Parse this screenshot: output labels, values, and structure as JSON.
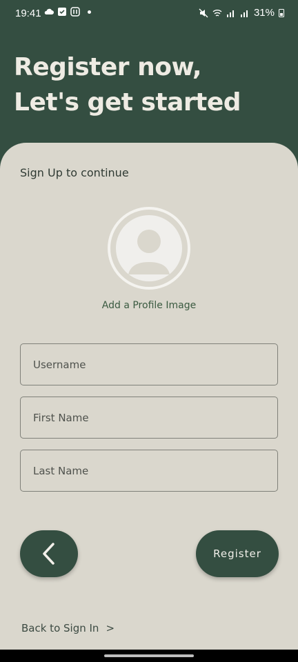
{
  "status_bar": {
    "time": "19:41",
    "battery": "31%"
  },
  "header": {
    "title_line1": "Register now,",
    "title_line2": "Let's get started"
  },
  "form": {
    "subtitle": "Sign Up to continue",
    "add_image_label": "Add a Profile Image",
    "username_placeholder": "Username",
    "first_name_placeholder": "First Name",
    "last_name_placeholder": "Last Name",
    "register_label": "Register",
    "back_to_signin_label": "Back to Sign In",
    "back_to_signin_arrow": ">"
  },
  "colors": {
    "primary": "#344E41",
    "card_bg": "#DAD7CD",
    "link_green": "#3A5A40"
  }
}
